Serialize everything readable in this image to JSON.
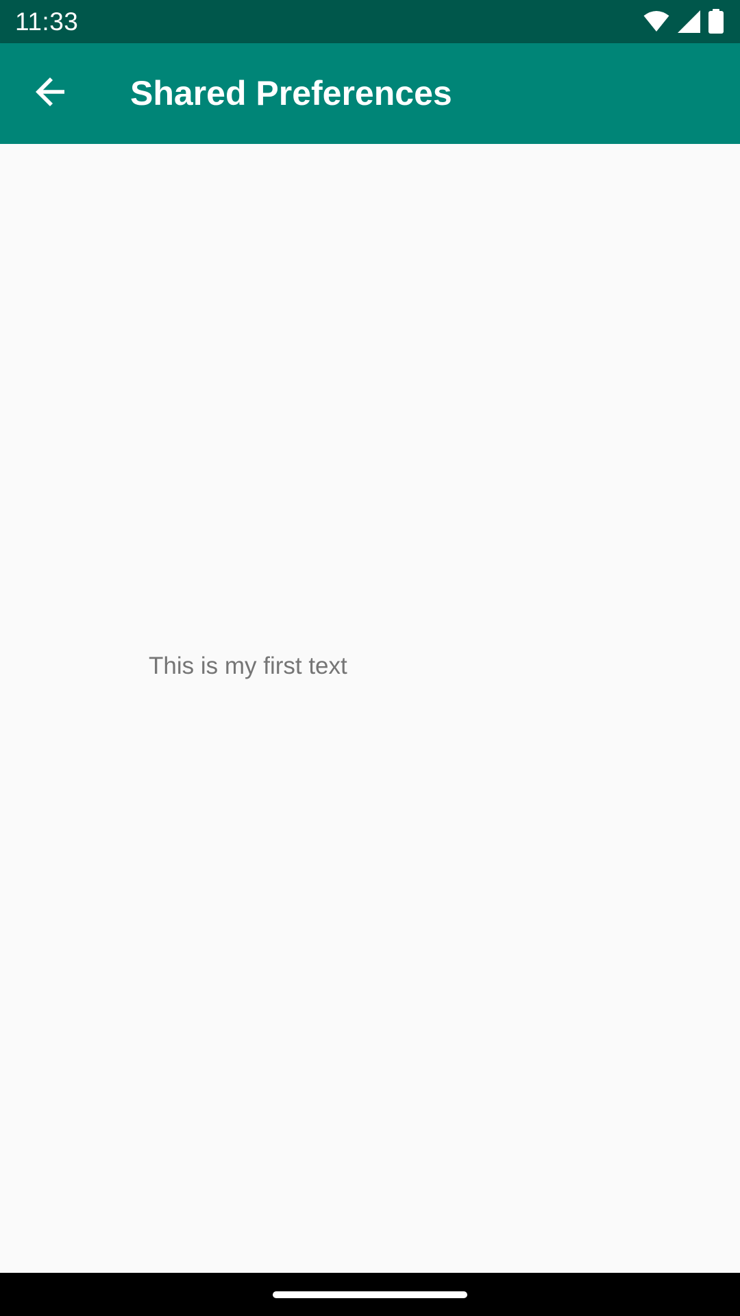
{
  "status_bar": {
    "time": "11:33",
    "icons": [
      "wifi-icon",
      "cellular-signal-icon",
      "battery-icon"
    ],
    "background": "#00574b"
  },
  "app_bar": {
    "title": "Shared Preferences",
    "back_icon": "arrow-back-icon",
    "background": "#008577"
  },
  "content": {
    "text": "This is my first text",
    "text_color": "#757575",
    "background": "#fafafa"
  },
  "nav_bar": {
    "background": "#000000",
    "handle": "home-gesture-handle"
  }
}
